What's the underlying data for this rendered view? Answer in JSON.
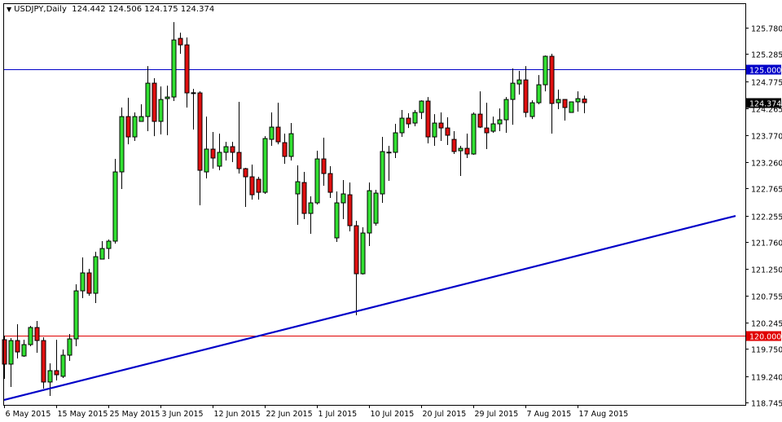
{
  "header": {
    "menu_icon": "triangle-down-icon",
    "symbol_timeframe": "USDJPY,Daily",
    "ohlc_readout": "124.442 124.506 124.175 124.374"
  },
  "colors": {
    "bull": "#32e032",
    "bear": "#e01010",
    "resistance": "#0000c8",
    "support": "#e00000",
    "trendline": "#0000c8",
    "current_price_tag": "#000000"
  },
  "chart_data": {
    "type": "candlestick",
    "title": "USDJPY,Daily",
    "ylim": [
      118.7,
      126.24
    ],
    "y_ticks": [
      "125.780",
      "125.285",
      "124.775",
      "124.265",
      "123.770",
      "123.260",
      "122.765",
      "122.255",
      "121.760",
      "121.250",
      "120.755",
      "120.245",
      "119.750",
      "119.240",
      "118.745"
    ],
    "x_labels": [
      {
        "bar": 0,
        "label": "6 May 2015"
      },
      {
        "bar": 8,
        "label": "15 May 2015"
      },
      {
        "bar": 16,
        "label": "25 May 2015"
      },
      {
        "bar": 24,
        "label": "3 Jun 2015"
      },
      {
        "bar": 32,
        "label": "12 Jun 2015"
      },
      {
        "bar": 40,
        "label": "22 Jun 2015"
      },
      {
        "bar": 48,
        "label": "1 Jul 2015"
      },
      {
        "bar": 56,
        "label": "10 Jul 2015"
      },
      {
        "bar": 64,
        "label": "20 Jul 2015"
      },
      {
        "bar": 72,
        "label": "29 Jul 2015"
      },
      {
        "bar": 80,
        "label": "7 Aug 2015"
      },
      {
        "bar": 88,
        "label": "17 Aug 2015"
      }
    ],
    "ohlc": [
      [
        119.924,
        120.0,
        119.19,
        119.465
      ],
      [
        119.465,
        119.954,
        119.037,
        119.908
      ],
      [
        119.908,
        120.214,
        119.572,
        119.694
      ],
      [
        119.618,
        119.924,
        119.603,
        119.832
      ],
      [
        119.832,
        120.184,
        119.801,
        120.153
      ],
      [
        120.153,
        120.275,
        119.679,
        119.908
      ],
      [
        119.908,
        119.97,
        119.006,
        119.129
      ],
      [
        119.129,
        119.48,
        118.869,
        119.343
      ],
      [
        119.343,
        119.924,
        119.159,
        119.266
      ],
      [
        119.236,
        119.74,
        119.205,
        119.633
      ],
      [
        119.633,
        120.031,
        119.526,
        119.939
      ],
      [
        119.939,
        120.963,
        119.801,
        120.841
      ],
      [
        120.841,
        121.468,
        120.703,
        121.178
      ],
      [
        121.178,
        121.254,
        120.749,
        120.795
      ],
      [
        120.795,
        121.575,
        120.612,
        121.483
      ],
      [
        121.437,
        121.774,
        121.437,
        121.636
      ],
      [
        121.636,
        121.804,
        121.437,
        121.774
      ],
      [
        121.774,
        123.318,
        121.728,
        123.074
      ],
      [
        123.074,
        124.282,
        122.752,
        124.113
      ],
      [
        124.113,
        124.465,
        123.593,
        123.731
      ],
      [
        123.731,
        124.19,
        123.655,
        124.113
      ],
      [
        124.022,
        124.343,
        124.022,
        124.113
      ],
      [
        124.113,
        125.061,
        123.838,
        124.74
      ],
      [
        124.74,
        124.832,
        123.746,
        124.022
      ],
      [
        124.022,
        124.679,
        123.777,
        124.434
      ],
      [
        124.45,
        124.694,
        123.762,
        124.48
      ],
      [
        124.48,
        125.887,
        124.404,
        125.551
      ],
      [
        125.581,
        125.688,
        125.291,
        125.459
      ],
      [
        125.459,
        125.597,
        124.282,
        124.557
      ],
      [
        124.557,
        124.633,
        123.869,
        124.56
      ],
      [
        124.557,
        124.587,
        122.447,
        123.104
      ],
      [
        123.074,
        124.113,
        122.951,
        123.502
      ],
      [
        123.502,
        123.823,
        123.135,
        123.334
      ],
      [
        123.181,
        123.792,
        123.104,
        123.441
      ],
      [
        123.441,
        123.639,
        123.288,
        123.548
      ],
      [
        123.548,
        123.639,
        123.257,
        123.441
      ],
      [
        123.441,
        124.389,
        123.043,
        123.135
      ],
      [
        123.135,
        123.15,
        122.416,
        122.982
      ],
      [
        122.982,
        123.211,
        122.554,
        122.645
      ],
      [
        122.936,
        122.982,
        122.554,
        122.691
      ],
      [
        122.691,
        123.746,
        122.661,
        123.701
      ],
      [
        123.685,
        124.19,
        123.563,
        123.915
      ],
      [
        123.915,
        124.373,
        123.593,
        123.639
      ],
      [
        123.624,
        123.792,
        123.226,
        123.364
      ],
      [
        123.364,
        123.991,
        123.288,
        123.792
      ],
      [
        122.661,
        123.196,
        122.08,
        122.89
      ],
      [
        122.875,
        123.074,
        122.187,
        122.294
      ],
      [
        122.294,
        122.615,
        121.911,
        122.493
      ],
      [
        122.493,
        123.471,
        122.462,
        123.318
      ],
      [
        123.318,
        123.716,
        122.814,
        123.043
      ],
      [
        123.043,
        123.181,
        122.584,
        122.691
      ],
      [
        121.835,
        122.707,
        121.759,
        122.493
      ],
      [
        122.493,
        122.921,
        122.187,
        122.661
      ],
      [
        122.645,
        122.875,
        121.957,
        122.064
      ],
      [
        122.064,
        122.156,
        120.382,
        121.162
      ],
      [
        121.162,
        122.034,
        121.147,
        121.927
      ],
      [
        121.927,
        122.875,
        121.682,
        122.722
      ],
      [
        122.11,
        122.737,
        122.064,
        122.676
      ],
      [
        122.661,
        123.731,
        122.493,
        123.456
      ],
      [
        123.441,
        123.563,
        122.905,
        123.445
      ],
      [
        123.441,
        123.976,
        123.334,
        123.808
      ],
      [
        123.808,
        124.236,
        123.731,
        124.083
      ],
      [
        124.083,
        124.175,
        123.899,
        123.976
      ],
      [
        123.991,
        124.236,
        123.93,
        124.19
      ],
      [
        124.19,
        124.419,
        124.067,
        124.404
      ],
      [
        124.404,
        124.48,
        123.609,
        123.731
      ],
      [
        123.731,
        124.159,
        123.563,
        123.991
      ],
      [
        123.991,
        124.19,
        123.655,
        123.899
      ],
      [
        123.899,
        124.098,
        123.578,
        123.762
      ],
      [
        123.685,
        123.838,
        123.41,
        123.456
      ],
      [
        123.471,
        123.563,
        122.997,
        123.517
      ],
      [
        123.517,
        123.792,
        123.334,
        123.41
      ],
      [
        123.41,
        124.19,
        123.395,
        124.159
      ],
      [
        124.159,
        124.587,
        123.899,
        123.915
      ],
      [
        123.899,
        124.373,
        123.502,
        123.808
      ],
      [
        123.838,
        124.113,
        123.808,
        123.976
      ],
      [
        123.976,
        124.266,
        123.838,
        124.052
      ],
      [
        124.052,
        124.48,
        123.808,
        124.434
      ],
      [
        124.434,
        125.016,
        123.96,
        124.74
      ],
      [
        124.725,
        124.97,
        124.526,
        124.801
      ],
      [
        124.801,
        125.061,
        124.098,
        124.19
      ],
      [
        124.113,
        124.419,
        124.067,
        124.373
      ],
      [
        124.373,
        124.893,
        124.343,
        124.71
      ],
      [
        124.71,
        125.26,
        124.587,
        125.245
      ],
      [
        125.245,
        125.291,
        123.792,
        124.358
      ],
      [
        124.373,
        124.618,
        124.251,
        124.434
      ],
      [
        124.434,
        124.434,
        124.037,
        124.282
      ],
      [
        124.19,
        124.389,
        124.19,
        124.389
      ],
      [
        124.389,
        124.587,
        124.205,
        124.45
      ],
      [
        124.442,
        124.506,
        124.175,
        124.374
      ]
    ],
    "horizontal_lines": [
      {
        "name": "resistance",
        "price": 125.0,
        "label": "125.000"
      },
      {
        "name": "support",
        "price": 120.0,
        "label": "120.000"
      }
    ],
    "trendline": {
      "start_bar": 0,
      "start_price": 118.792,
      "end_bar": 112.25,
      "end_price": 122.248
    },
    "current_price": {
      "price": 124.374,
      "label": "124.374"
    }
  }
}
